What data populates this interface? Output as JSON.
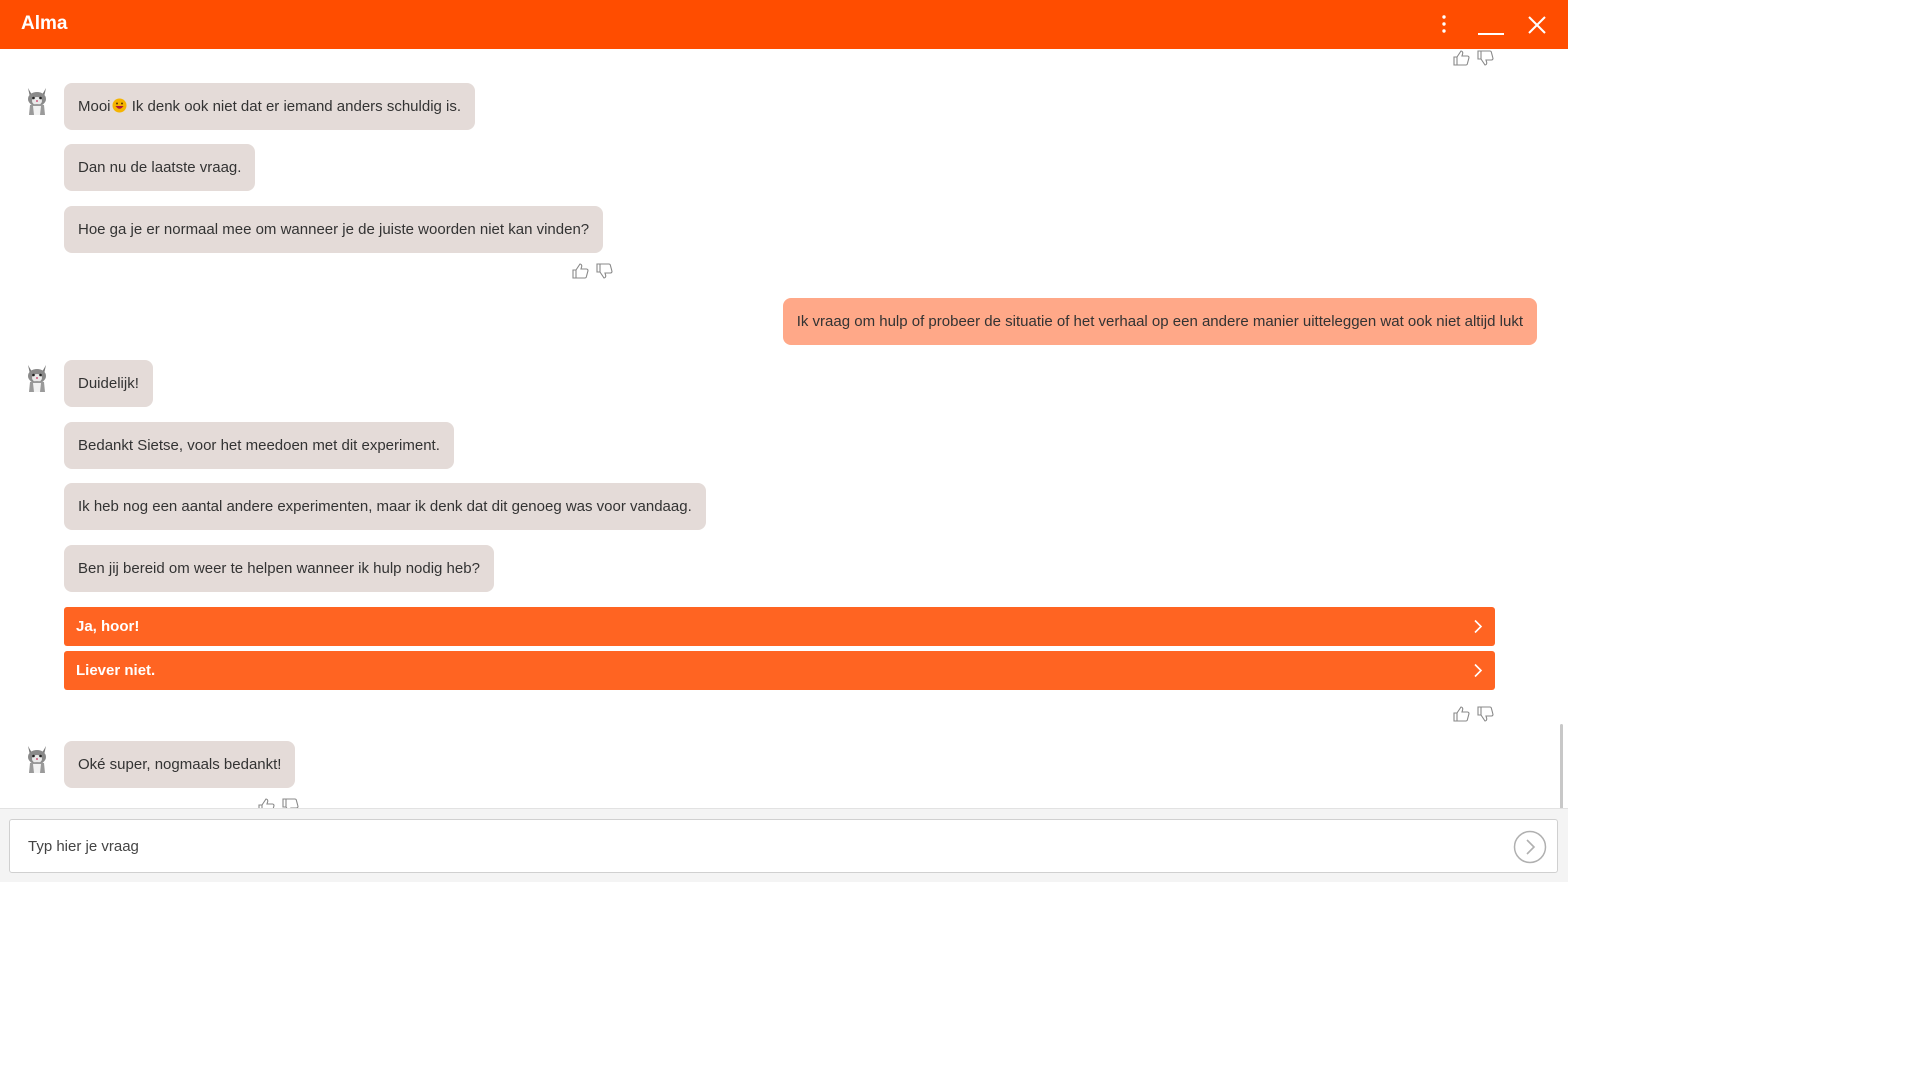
{
  "app": {
    "title": "Alma"
  },
  "header": {
    "icons": {
      "menu": "kebab-menu-icon",
      "minimize": "minimize-icon",
      "close": "close-icon"
    },
    "color": "#ff4d00"
  },
  "messages": [
    {
      "from": "bot",
      "text_before": "Mooi",
      "emoji": "grinning-face-emoji",
      "text_after": "Ik denk ook niet dat er iemand anders schuldig is."
    },
    {
      "from": "bot",
      "text": "Dan nu de laatste vraag."
    },
    {
      "from": "bot",
      "text": "Hoe ga je er normaal mee om wanneer je de juiste woorden niet kan vinden?"
    },
    {
      "from": "user",
      "text": "Ik vraag om hulp of probeer de situatie of het verhaal op een andere manier uitteleggen wat ook niet altijd lukt"
    },
    {
      "from": "bot",
      "text": "Duidelijk!"
    },
    {
      "from": "bot",
      "text": "Bedankt Sietse, voor het meedoen met dit experiment."
    },
    {
      "from": "bot",
      "text": "Ik heb nog een aantal andere experimenten, maar ik denk dat dit genoeg was voor vandaag."
    },
    {
      "from": "bot",
      "text": "Ben jij bereid om weer te helpen wanneer ik hulp nodig heb?"
    },
    {
      "from": "bot",
      "text": "Oké super, nogmaals bedankt!"
    }
  ],
  "choices": [
    {
      "label": "Ja, hoor!"
    },
    {
      "label": "Liever niet."
    }
  ],
  "input": {
    "placeholder": "Typ hier je vraag",
    "value": ""
  },
  "colors": {
    "bot_bubble": "#e4dbd8",
    "user_bubble": "#ffa888",
    "choice_button": "#ff6422"
  }
}
